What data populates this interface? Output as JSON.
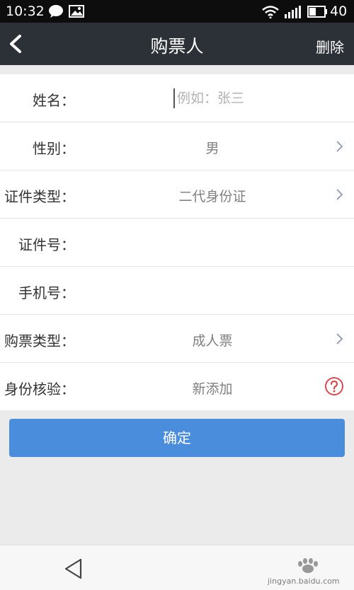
{
  "status_bar": {
    "time": "10:32",
    "battery": "40",
    "icons": [
      "chat-bubble-icon",
      "image-icon",
      "wifi-icon",
      "signal-icon",
      "battery-icon"
    ]
  },
  "nav": {
    "title": "购票人",
    "delete_label": "删除",
    "background": "#2c3138"
  },
  "form": {
    "name": {
      "label": "姓名：",
      "placeholder": "例如：张三",
      "value": ""
    },
    "gender": {
      "label": "性别：",
      "value": "男"
    },
    "id_type": {
      "label": "证件类型：",
      "value": "二代身份证"
    },
    "id_number": {
      "label": "证件号：",
      "value": ""
    },
    "phone": {
      "label": "手机号：",
      "value": ""
    },
    "ticket_type": {
      "label": "购票类型：",
      "value": "成人票"
    },
    "id_verify": {
      "label": "身份核验：",
      "value": "新添加"
    }
  },
  "confirm_label": "确定",
  "confirm_color": "#4a8ddc",
  "help_icon_color": "#e0393e",
  "watermark": {
    "text": "jingyan.baidu.com"
  }
}
